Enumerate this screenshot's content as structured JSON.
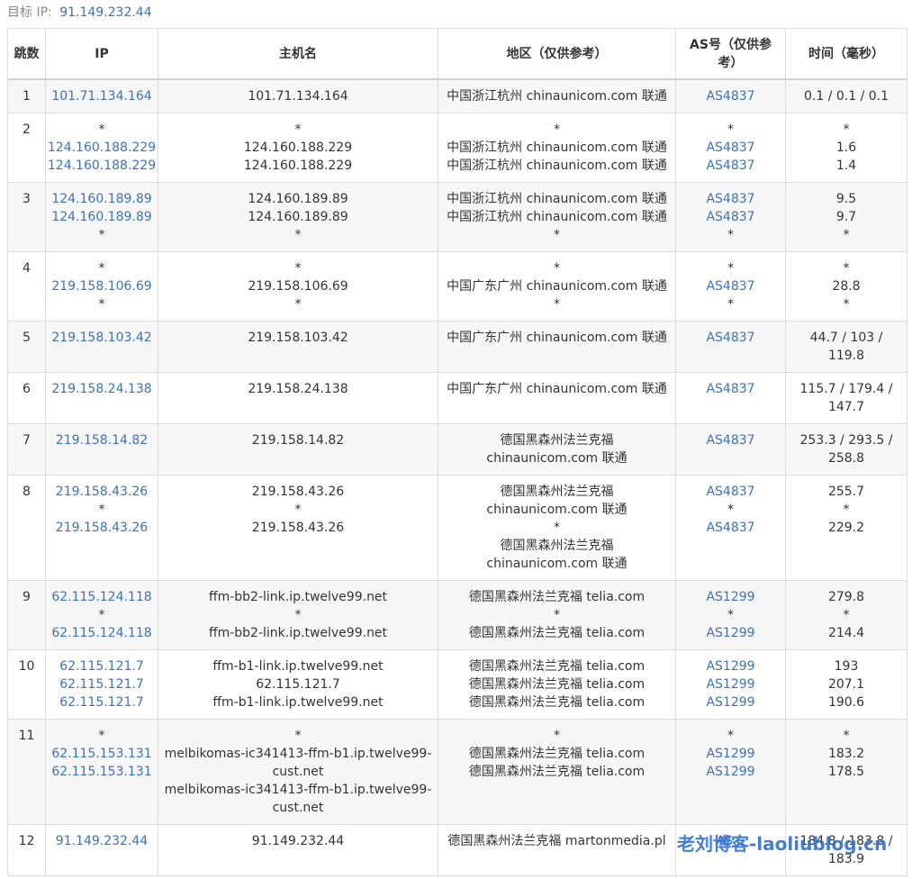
{
  "target": {
    "label": "目标 IP:",
    "ip": "91.149.232.44"
  },
  "headers": {
    "hop": "跳数",
    "ip": "IP",
    "hostname": "主机名",
    "region": "地区（仅供参考）",
    "as": "AS号（仅供参考）",
    "time": "时间（毫秒）"
  },
  "rows": [
    {
      "hop": "1",
      "ip": [
        "101.71.134.164"
      ],
      "host": [
        "101.71.134.164"
      ],
      "region": [
        "中国浙江杭州 chinaunicom.com 联通"
      ],
      "as": [
        "AS4837"
      ],
      "time": [
        "0.1 / 0.1 / 0.1"
      ]
    },
    {
      "hop": "2",
      "ip": [
        "*",
        "124.160.188.229",
        "124.160.188.229"
      ],
      "host": [
        "*",
        "124.160.188.229",
        "124.160.188.229"
      ],
      "region": [
        "*",
        "中国浙江杭州 chinaunicom.com 联通",
        "中国浙江杭州 chinaunicom.com 联通"
      ],
      "as": [
        "*",
        "AS4837",
        "AS4837"
      ],
      "time": [
        "*",
        "1.6",
        "1.4"
      ]
    },
    {
      "hop": "3",
      "ip": [
        "124.160.189.89",
        "124.160.189.89",
        "*"
      ],
      "host": [
        "124.160.189.89",
        "124.160.189.89",
        "*"
      ],
      "region": [
        "中国浙江杭州 chinaunicom.com 联通",
        "中国浙江杭州 chinaunicom.com 联通",
        "*"
      ],
      "as": [
        "AS4837",
        "AS4837",
        "*"
      ],
      "time": [
        "9.5",
        "9.7",
        "*"
      ]
    },
    {
      "hop": "4",
      "ip": [
        "*",
        "219.158.106.69",
        "*"
      ],
      "host": [
        "*",
        "219.158.106.69",
        "*"
      ],
      "region": [
        "*",
        "中国广东广州 chinaunicom.com 联通",
        "*"
      ],
      "as": [
        "*",
        "AS4837",
        "*"
      ],
      "time": [
        "*",
        "28.8",
        "*"
      ]
    },
    {
      "hop": "5",
      "ip": [
        "219.158.103.42"
      ],
      "host": [
        "219.158.103.42"
      ],
      "region": [
        "中国广东广州 chinaunicom.com 联通"
      ],
      "as": [
        "AS4837"
      ],
      "time": [
        "44.7 / 103 /",
        "119.8"
      ]
    },
    {
      "hop": "6",
      "ip": [
        "219.158.24.138"
      ],
      "host": [
        "219.158.24.138"
      ],
      "region": [
        "中国广东广州 chinaunicom.com 联通"
      ],
      "as": [
        "AS4837"
      ],
      "time": [
        "115.7 / 179.4 /",
        "147.7"
      ]
    },
    {
      "hop": "7",
      "ip": [
        "219.158.14.82"
      ],
      "host": [
        "219.158.14.82"
      ],
      "region": [
        "德国黑森州法兰克福",
        "chinaunicom.com 联通"
      ],
      "as": [
        "AS4837"
      ],
      "time": [
        "253.3 / 293.5 /",
        "258.8"
      ]
    },
    {
      "hop": "8",
      "ip": [
        "219.158.43.26",
        "*",
        "219.158.43.26"
      ],
      "host": [
        "219.158.43.26",
        "*",
        "219.158.43.26"
      ],
      "region": [
        "德国黑森州法兰克福",
        "chinaunicom.com 联通",
        "*",
        "德国黑森州法兰克福",
        "chinaunicom.com 联通"
      ],
      "as": [
        "AS4837",
        "*",
        "AS4837"
      ],
      "time": [
        "255.7",
        "*",
        "229.2"
      ]
    },
    {
      "hop": "9",
      "ip": [
        "62.115.124.118",
        "*",
        "62.115.124.118"
      ],
      "host": [
        "ffm-bb2-link.ip.twelve99.net",
        "*",
        "ffm-bb2-link.ip.twelve99.net"
      ],
      "region": [
        "德国黑森州法兰克福 telia.com",
        "*",
        "德国黑森州法兰克福 telia.com"
      ],
      "as": [
        "AS1299",
        "*",
        "AS1299"
      ],
      "time": [
        "279.8",
        "*",
        "214.4"
      ]
    },
    {
      "hop": "10",
      "ip": [
        "62.115.121.7",
        "62.115.121.7",
        "62.115.121.7"
      ],
      "host": [
        "ffm-b1-link.ip.twelve99.net",
        "62.115.121.7",
        "ffm-b1-link.ip.twelve99.net"
      ],
      "region": [
        "德国黑森州法兰克福 telia.com",
        "德国黑森州法兰克福 telia.com",
        "德国黑森州法兰克福 telia.com"
      ],
      "as": [
        "AS1299",
        "AS1299",
        "AS1299"
      ],
      "time": [
        "193",
        "207.1",
        "190.6"
      ]
    },
    {
      "hop": "11",
      "ip": [
        "*",
        "62.115.153.131",
        "62.115.153.131"
      ],
      "host": [
        "*",
        "melbikomas-ic341413-ffm-b1.ip.twelve99-",
        "cust.net",
        "melbikomas-ic341413-ffm-b1.ip.twelve99-",
        "cust.net"
      ],
      "region": [
        "*",
        "德国黑森州法兰克福 telia.com",
        "德国黑森州法兰克福 telia.com"
      ],
      "as": [
        "*",
        "AS1299",
        "AS1299"
      ],
      "time": [
        "*",
        "183.2",
        "178.5"
      ]
    },
    {
      "hop": "12",
      "ip": [
        "91.149.232.44"
      ],
      "host": [
        "91.149.232.44"
      ],
      "region": [
        "德国黑森州法兰克福 martonmedia.pl"
      ],
      "as": [
        "AS..."
      ],
      "time": [
        "184.8 / 183.8 /",
        "183.9"
      ]
    }
  ],
  "watermark": "老刘博客-laoliublog.cn",
  "colors": {
    "link": "#3b73b9",
    "border": "#dcdcdc",
    "stripe": "#f7f7f7",
    "watermark": "#2f6fd0"
  }
}
